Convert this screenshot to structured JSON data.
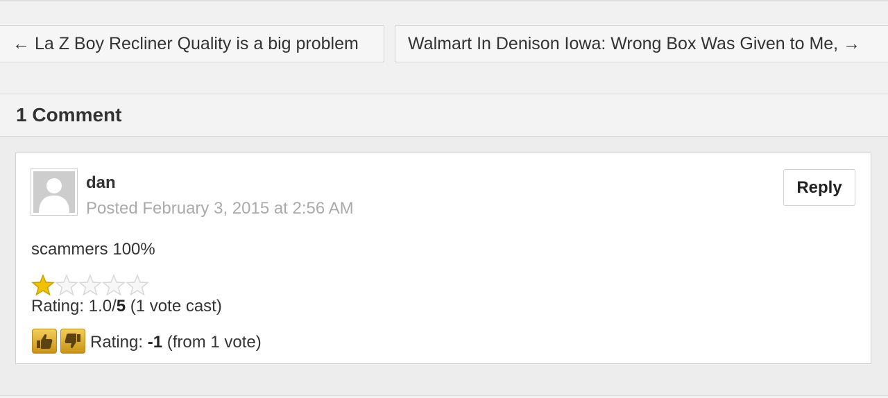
{
  "post_nav": {
    "prev_label": "← La Z Boy Recliner Quality is a big problem",
    "next_label": "Walmart In Denison Iowa: Wrong Box Was Given to Me, →"
  },
  "comments": {
    "title": "1 Comment",
    "items": [
      {
        "author": "dan",
        "posted": "Posted February 3, 2015 at 2:56 AM",
        "reply_label": "Reply",
        "body": "scammers 100%",
        "star_rating": {
          "stars_filled": 1,
          "stars_total": 5,
          "label": "Rating: ",
          "score": "1.0",
          "separator": "/",
          "max": "5",
          "votes": " (1 vote cast)"
        },
        "thumb_rating": {
          "label": "Rating: ",
          "score": "-1",
          "votes": " (from 1 vote)"
        }
      }
    ]
  },
  "colors": {
    "star_filled": "#f2c200",
    "star_empty": "#d8d8d8",
    "thumb_button": "#d9a520"
  },
  "icons": {
    "avatar": "default-user-avatar",
    "thumb_up": "thumbs-up-icon",
    "thumb_down": "thumbs-down-icon",
    "star": "star-icon"
  }
}
